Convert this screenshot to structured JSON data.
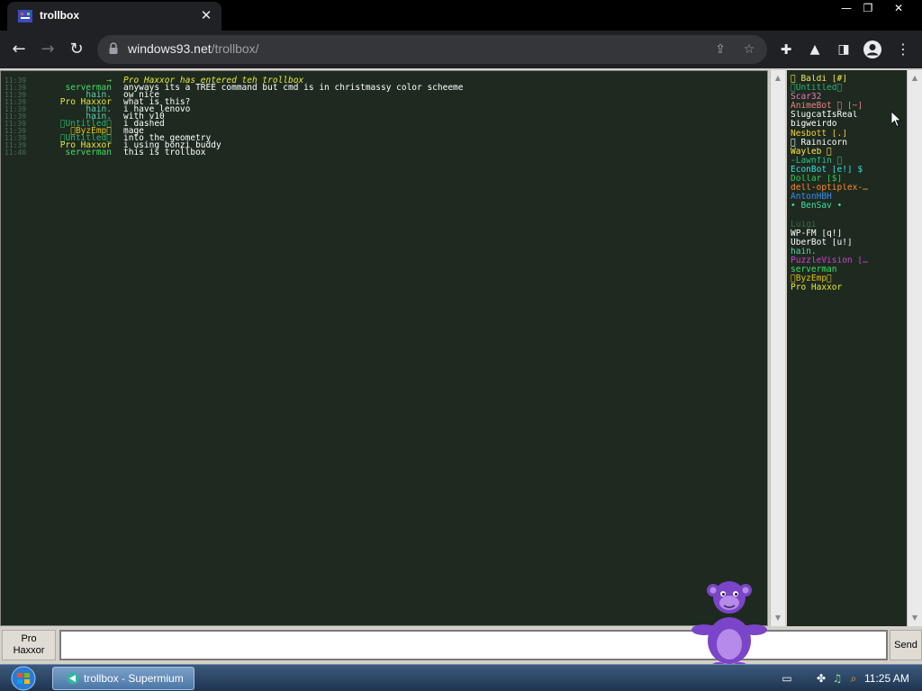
{
  "browser": {
    "tab_title": "trollbox",
    "url_host": "windows93.net",
    "url_path": "/trollbox/"
  },
  "chat": {
    "messages": [
      {
        "time": "11:39",
        "nick": "→",
        "nick_color": "#4de04d",
        "text": "Pro Haxxor has entered teh trollbox",
        "system": true
      },
      {
        "time": "11:39",
        "nick": "serverman",
        "nick_color": "#44dd66",
        "text": "anyways its a TREE command but cmd is in christmassy color scheeme",
        "system": false
      },
      {
        "time": "11:39",
        "nick": "hain.",
        "nick_color": "#5fd0a8",
        "text": "ow nice",
        "system": false
      },
      {
        "time": "11:39",
        "nick": "Pro Haxxor",
        "nick_color": "#e7e93a",
        "text": "what is this?",
        "system": false
      },
      {
        "time": "11:39",
        "nick": "hain.",
        "nick_color": "#5fd0a8",
        "text": "i have lenovo",
        "system": false
      },
      {
        "time": "11:39",
        "nick": "hain.",
        "nick_color": "#5fd0a8",
        "text": "with v10",
        "system": false
      },
      {
        "time": "11:39",
        "nick": "\u0000Untitled\u0000",
        "nick_color": "#2fb070",
        "text": "i dashed",
        "system": false
      },
      {
        "time": "11:39",
        "nick": "\u0000ByzEmp\u0000",
        "nick_color": "#e0c21a",
        "text": "mage",
        "system": false
      },
      {
        "time": "11:39",
        "nick": "\u0000Untitled\u0000",
        "nick_color": "#2fb070",
        "text": "into the geometry",
        "system": false
      },
      {
        "time": "11:39",
        "nick": "Pro Haxxor",
        "nick_color": "#e7e93a",
        "text": "i using bonzi buddy",
        "system": false
      },
      {
        "time": "11:40",
        "nick": "serverman",
        "nick_color": "#44dd66",
        "text": "this is trollbox",
        "system": false
      }
    ]
  },
  "users": [
    {
      "name": "\u0000 Baldi [#]",
      "color": "#f4e54b"
    },
    {
      "name": "\u0000Untitled\u0000",
      "color": "#2fb070"
    },
    {
      "name": "Scar32",
      "color": "#e87cb8"
    },
    {
      "name": "AnimeBot \u0000 [~]",
      "color": "#f08080"
    },
    {
      "name": "SlugcatIsReal",
      "color": "#ffffff"
    },
    {
      "name": "bigweirdo",
      "color": "#ffffff"
    },
    {
      "name": "Nesbott [.]",
      "color": "#f4d030"
    },
    {
      "name": "\u0000 Rainicorn",
      "color": "#ffffff"
    },
    {
      "name": "Wayleb \u0000",
      "color": "#ffe74b"
    },
    {
      "name": "-Lawnfin \u0000",
      "color": "#22c088"
    },
    {
      "name": "EconBot [e!] $",
      "color": "#36e0e0"
    },
    {
      "name": "Dollar [$]",
      "color": "#33cc55"
    },
    {
      "name": "dell-optiplex-…",
      "color": "#ff8a2b"
    },
    {
      "name": "AntonHBH",
      "color": "#3a8df0"
    },
    {
      "name": "• BenSav •",
      "color": "#3fe0a0"
    },
    {
      "name": "",
      "color": "#555555"
    },
    {
      "name": "Luigi",
      "color": "#3a6a3a"
    },
    {
      "name": "WP-FM [q!]",
      "color": "#ffffff"
    },
    {
      "name": "UberBot [u!]",
      "color": "#ffffff"
    },
    {
      "name": "hain.",
      "color": "#5fd0a8"
    },
    {
      "name": "PuzzleVision […",
      "color": "#d040d0"
    },
    {
      "name": "serverman",
      "color": "#44dd66"
    },
    {
      "name": "\u0000ByzEmp\u0000",
      "color": "#e0c21a"
    },
    {
      "name": "Pro Haxxor",
      "color": "#e7e93a"
    }
  ],
  "bottom": {
    "nick_line1": "Pro",
    "nick_line2": "Haxxor",
    "send_label": "Send",
    "input_value": ""
  },
  "taskbar": {
    "task_label": "trollbox - Supermium",
    "clock": "11:25 AM"
  }
}
